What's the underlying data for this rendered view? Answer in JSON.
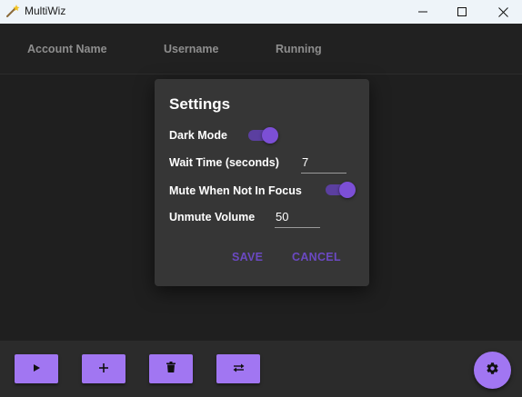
{
  "window": {
    "title": "MultiWiz",
    "icon": "magic-wand-icon"
  },
  "table": {
    "columns": [
      "Account Name",
      "Username",
      "Running"
    ]
  },
  "settings": {
    "title": "Settings",
    "dark_mode": {
      "label": "Dark Mode",
      "enabled": true
    },
    "wait_time": {
      "label": "Wait Time (seconds)",
      "value": "7"
    },
    "mute_focus": {
      "label": "Mute When Not In Focus",
      "enabled": true
    },
    "unmute_volume": {
      "label": "Unmute Volume",
      "value": "50"
    },
    "save_label": "SAVE",
    "cancel_label": "CANCEL"
  },
  "toolbar": {
    "buttons": [
      {
        "icon": "play-icon"
      },
      {
        "icon": "plus-icon"
      },
      {
        "icon": "trash-icon"
      },
      {
        "icon": "swap-icon"
      }
    ],
    "fab_icon": "gear-icon"
  },
  "colors": {
    "accent": "#a176f2",
    "accent_dark": "#6b49c2",
    "background": "#1f1f1f",
    "dialog": "#363636"
  }
}
